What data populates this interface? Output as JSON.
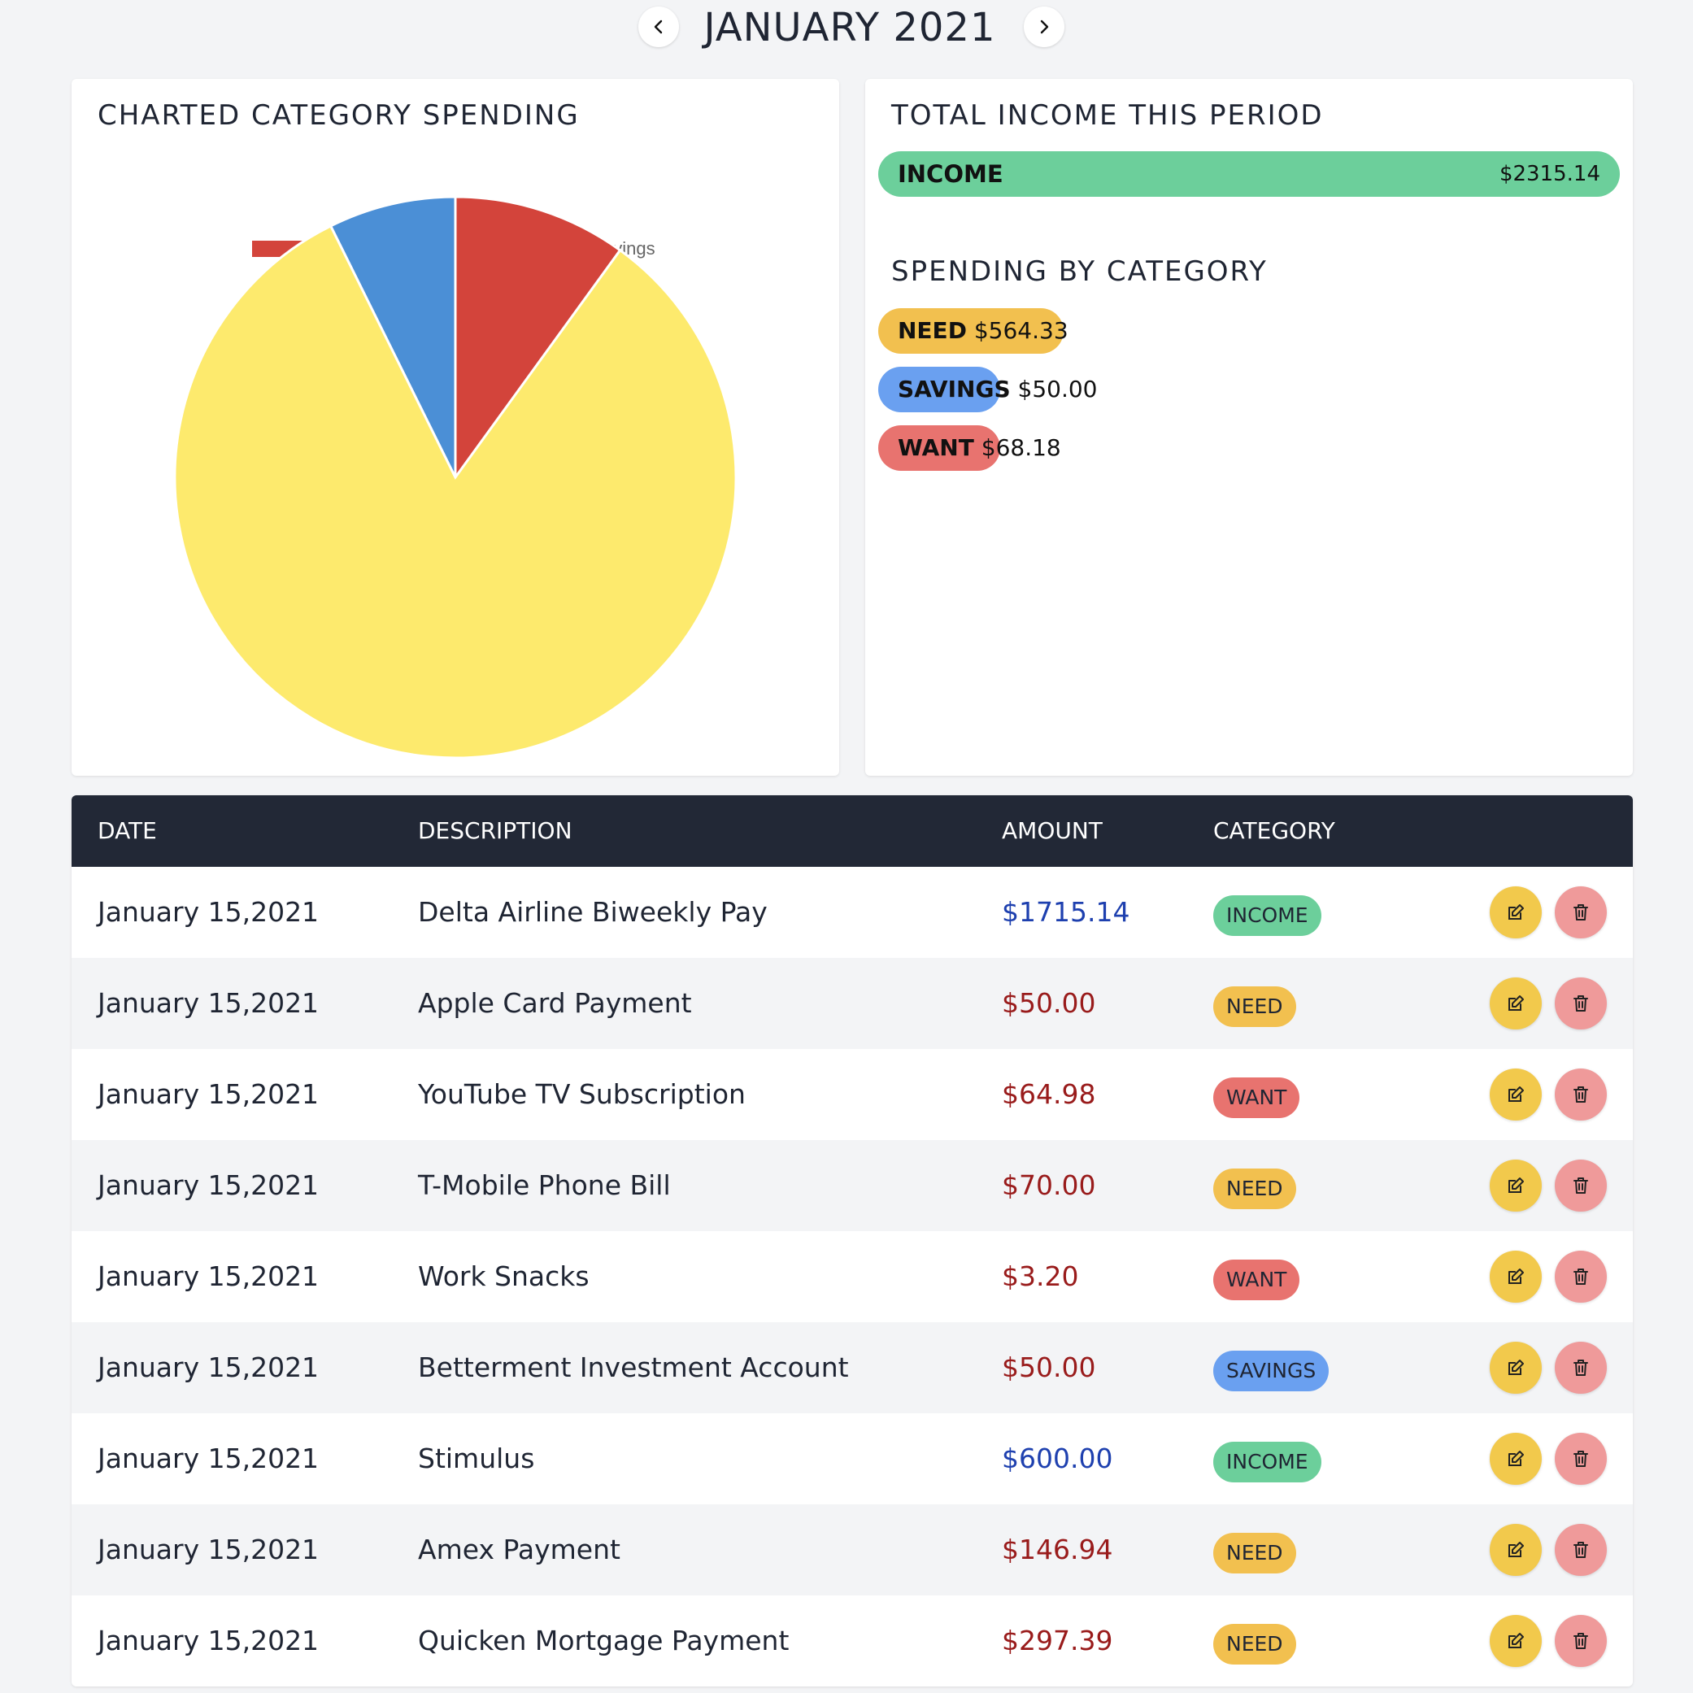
{
  "header": {
    "month_label": "JANUARY 2021",
    "prev_icon": "chevron-left-icon",
    "next_icon": "chevron-right-icon"
  },
  "chart_card": {
    "title": "CHARTED CATEGORY SPENDING"
  },
  "chart_data": {
    "type": "pie",
    "title": "",
    "legend_placement": "top",
    "categories": [
      "want",
      "need",
      "savings"
    ],
    "values": [
      68.18,
      564.33,
      50.0
    ],
    "colors": [
      "#d3443b",
      "#fdea6d",
      "#4b8fd6"
    ]
  },
  "summary_card": {
    "income_title": "TOTAL INCOME THIS PERIOD",
    "income_label": "INCOME",
    "income_value": "$2315.14",
    "income_color": "#6ccf9b",
    "spending_title": "SPENDING BY CATEGORY",
    "categories": [
      {
        "name": "NEED",
        "value": "$564.33",
        "color": "#f2c04f"
      },
      {
        "name": "SAVINGS",
        "value": "$50.00",
        "color": "#6aa0f0"
      },
      {
        "name": "WANT",
        "value": "$68.18",
        "color": "#e8736f"
      }
    ]
  },
  "table": {
    "headers": {
      "date": "DATE",
      "description": "DESCRIPTION",
      "amount": "AMOUNT",
      "category": "CATEGORY"
    },
    "badge_colors": {
      "INCOME": "#6ccf9b",
      "NEED": "#f2c04f",
      "WANT": "#e8736f",
      "SAVINGS": "#6aa0f0"
    },
    "edit_icon": "edit-icon",
    "delete_icon": "trash-icon",
    "edit_color": "#f2c94c",
    "delete_color": "#ef9a9a",
    "rows": [
      {
        "date": "January 15,2021",
        "description": "Delta Airline Biweekly Pay",
        "amount": "$1715.14",
        "category": "INCOME",
        "type": "income"
      },
      {
        "date": "January 15,2021",
        "description": "Apple Card Payment",
        "amount": "$50.00",
        "category": "NEED",
        "type": "expense"
      },
      {
        "date": "January 15,2021",
        "description": "YouTube TV Subscription",
        "amount": "$64.98",
        "category": "WANT",
        "type": "expense"
      },
      {
        "date": "January 15,2021",
        "description": "T-Mobile Phone Bill",
        "amount": "$70.00",
        "category": "NEED",
        "type": "expense"
      },
      {
        "date": "January 15,2021",
        "description": "Work Snacks",
        "amount": "$3.20",
        "category": "WANT",
        "type": "expense"
      },
      {
        "date": "January 15,2021",
        "description": "Betterment Investment Account",
        "amount": "$50.00",
        "category": "SAVINGS",
        "type": "expense"
      },
      {
        "date": "January 15,2021",
        "description": "Stimulus",
        "amount": "$600.00",
        "category": "INCOME",
        "type": "income"
      },
      {
        "date": "January 15,2021",
        "description": "Amex Payment",
        "amount": "$146.94",
        "category": "NEED",
        "type": "expense"
      },
      {
        "date": "January 15,2021",
        "description": "Quicken Mortgage Payment",
        "amount": "$297.39",
        "category": "NEED",
        "type": "expense"
      }
    ]
  }
}
